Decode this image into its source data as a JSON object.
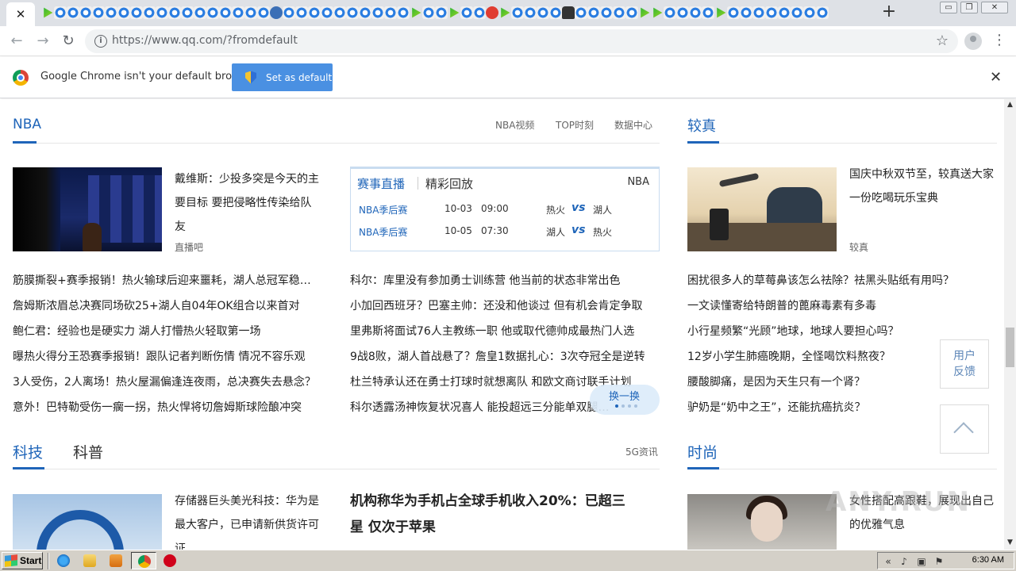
{
  "browser": {
    "close_tab_glyph": "✕",
    "new_tab_glyph": "+",
    "url": "https://www.qq.com/?fromdefault",
    "back_glyph": "←",
    "forward_glyph": "→",
    "reload_glyph": "↻",
    "info_glyph": "i",
    "star_glyph": "☆",
    "menu_glyph": "⋮",
    "win_minimize": "▭",
    "win_restore": "❐",
    "win_close": "✕"
  },
  "infobar": {
    "message": "Google Chrome isn't your default browser",
    "set_default_label": "Set as default",
    "close_glyph": "✕"
  },
  "nba": {
    "title": "NBA",
    "links": [
      "NBA视频",
      "TOP时刻",
      "数据中心"
    ],
    "headline": {
      "line1": "戴维斯：少投多突是今天的主",
      "line2": "要目标 要把侵略性传染给队",
      "line3": "友",
      "source": "直播吧"
    },
    "live": {
      "tab_active": "赛事直播",
      "tab_other": "精彩回放",
      "tab_right": "NBA",
      "matches": [
        {
          "stage": "NBA季后赛",
          "date": "10-03",
          "time": "09:00",
          "home": "热火",
          "vs": "vs",
          "away": "湖人"
        },
        {
          "stage": "NBA季后赛",
          "date": "10-05",
          "time": "07:30",
          "home": "湖人",
          "vs": "vs",
          "away": "热火"
        }
      ]
    },
    "left_news": [
      "筋膜撕裂+赛季报销！热火输球后迎来噩耗，湖人总冠军稳…",
      "詹姆斯浓眉总决赛同场砍25+湖人自04年OK组合以来首对",
      "鲍仁君：经验也是硬实力 湖人打懵热火轻取第一场",
      "曝热火得分王恐赛季报销！跟队记者判断伤情 情况不容乐观",
      "3人受伤，2人离场！热火屋漏偏逢连夜雨，总决赛失去悬念？",
      "意外！巴特勒受伤一瘸一拐，热火悍将切詹姆斯球险酿冲突"
    ],
    "mid_news": [
      "科尔：库里没有参加勇士训练营 他当前的状态非常出色",
      "小加回西班牙？巴塞主帅：还没和他谈过 但有机会肯定争取",
      "里弗斯将面试76人主教练一职 他或取代德帅成最热门人选",
      "9战8败，湖人首战悬了？詹皇1数据扎心：3次夺冠全是逆转",
      "杜兰特承认还在勇士打球时就想离队 和欧文商讨联手计划",
      "科尔透露汤神恢复状况喜人 能投超远三分能单双腿…"
    ],
    "refresh_label": "换一换"
  },
  "jiaozhen": {
    "title": "较真",
    "headline": {
      "line1": "国庆中秋双节至，较真送大家",
      "line2": "一份吃喝玩乐宝典",
      "source": "较真"
    },
    "news": [
      "困扰很多人的草莓鼻该怎么祛除？祛黑头贴纸有用吗？",
      "一文读懂寄给特朗普的蓖麻毒素有多毒",
      "小行星频繁“光顾”地球，地球人要担心吗？",
      "12岁小学生肺癌晚期，全怪喝饮料熬夜？",
      "腰酸脚痛，是因为天生只有一个肾？",
      "驴奶是“奶中之王”，还能抗癌抗炎？"
    ]
  },
  "tech": {
    "title": "科技",
    "tab2": "科普",
    "link": "5G资讯",
    "headline": {
      "line1": "存储器巨头美光科技：华为是",
      "line2": "最大客户，已申请新供货许可",
      "line3": "证"
    },
    "big_headline": {
      "line1": "机构称华为手机占全球手机收入20%：已超三",
      "line2": "星 仅次于苹果"
    }
  },
  "fashion": {
    "title": "时尚",
    "headline": {
      "line1": "女性搭配高跟鞋，展现出自己",
      "line2": "的优雅气息"
    }
  },
  "floaters": {
    "feedback_line1": "用户",
    "feedback_line2": "反馈"
  },
  "watermark": "ANY.RUN",
  "taskbar": {
    "start_label": "Start",
    "time": "6:30 AM"
  },
  "colors": {
    "accent": "#1f65b9",
    "set_default_bg": "#4a90e2"
  }
}
